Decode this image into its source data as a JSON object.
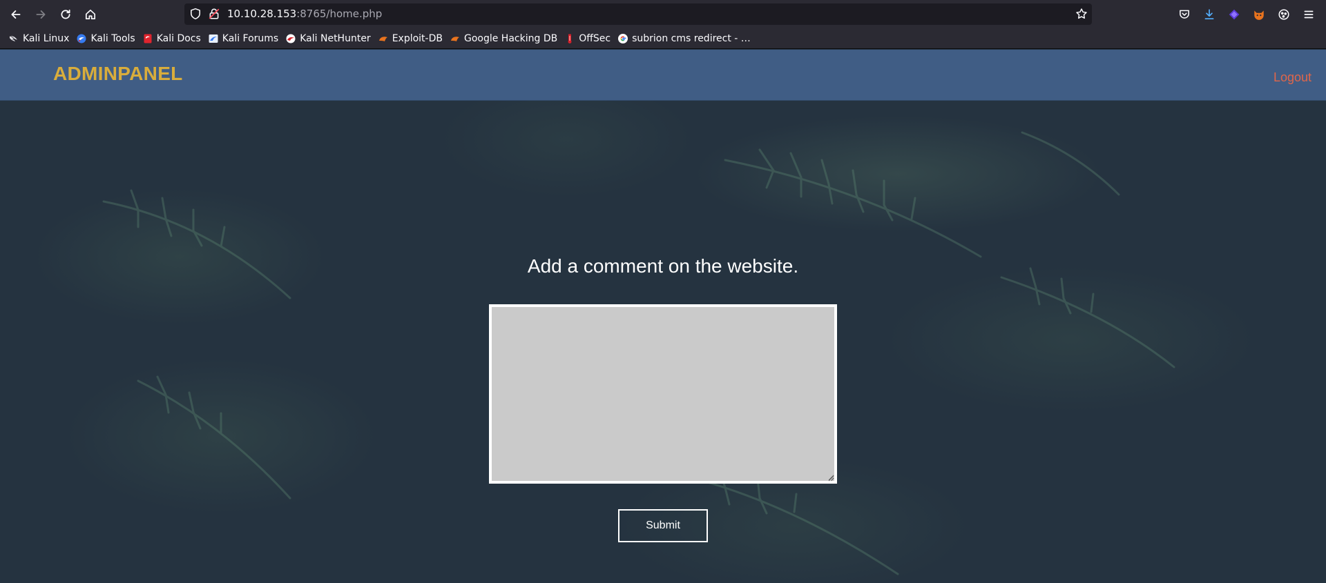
{
  "browser": {
    "url_host": "10.10.28.153",
    "url_rest": ":8765/home.php",
    "bookmarks": [
      {
        "label": "Kali Linux",
        "icon": "kali-dragon-icon"
      },
      {
        "label": "Kali Tools",
        "icon": "kali-tools-icon"
      },
      {
        "label": "Kali Docs",
        "icon": "kali-docs-icon"
      },
      {
        "label": "Kali Forums",
        "icon": "kali-forums-icon"
      },
      {
        "label": "Kali NetHunter",
        "icon": "kali-nethunter-icon"
      },
      {
        "label": "Exploit-DB",
        "icon": "exploit-db-icon"
      },
      {
        "label": "Google Hacking DB",
        "icon": "ghdb-icon"
      },
      {
        "label": "OffSec",
        "icon": "offsec-icon"
      },
      {
        "label": "subrion cms redirect - …",
        "icon": "google-icon"
      }
    ]
  },
  "site": {
    "brand": "ADMINPANEL",
    "logout_label": "Logout",
    "heading": "Add a comment on the website.",
    "comment_value": "",
    "submit_label": "Submit"
  },
  "colors": {
    "brand": "#d9ad3c",
    "logout": "#e0664a",
    "header_bg": "#405d85",
    "page_bg": "#253340",
    "textarea_bg": "#cacaca"
  }
}
